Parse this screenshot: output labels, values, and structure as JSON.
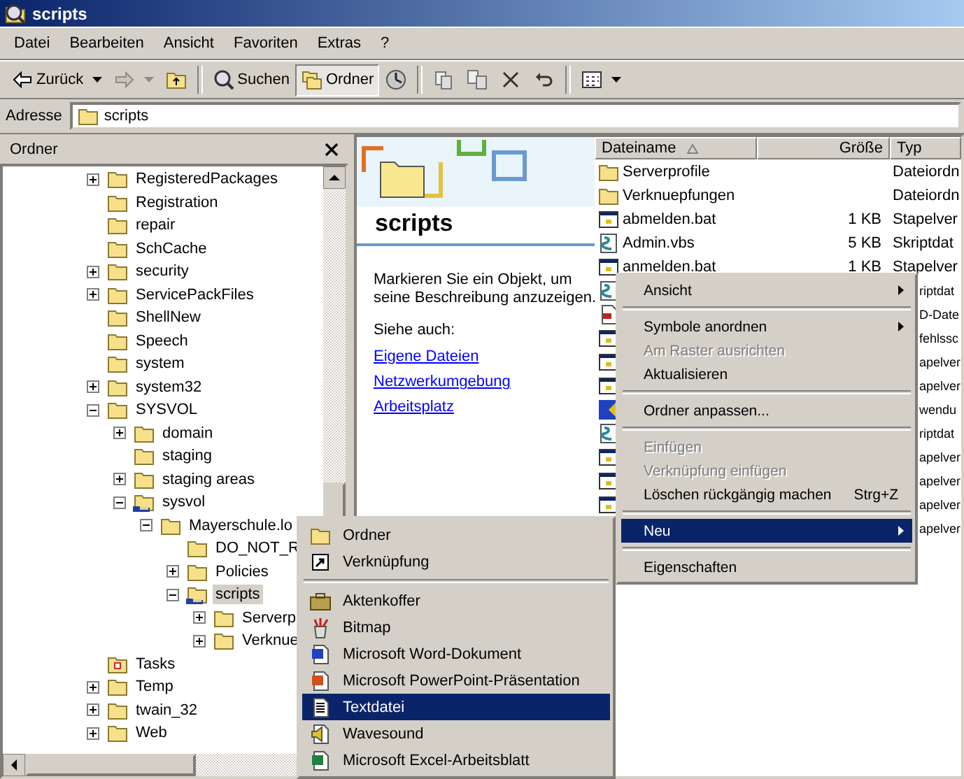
{
  "window": {
    "title": "scripts"
  },
  "menu_bar": [
    "Datei",
    "Bearbeiten",
    "Ansicht",
    "Favoriten",
    "Extras",
    "?"
  ],
  "toolbar": [
    {
      "kind": "back",
      "label": "Zurück",
      "disabled": false
    },
    {
      "kind": "forward",
      "disabled": true
    },
    {
      "kind": "up"
    },
    {
      "kind": "separator"
    },
    {
      "kind": "search",
      "label": "Suchen",
      "pressed": false
    },
    {
      "kind": "folders",
      "label": "Ordner",
      "pressed": true
    },
    {
      "kind": "history"
    },
    {
      "kind": "separator"
    },
    {
      "kind": "move"
    },
    {
      "kind": "copy"
    },
    {
      "kind": "delete"
    },
    {
      "kind": "undo"
    },
    {
      "kind": "separator"
    },
    {
      "kind": "views"
    }
  ],
  "address": {
    "label": "Adresse",
    "value": "scripts"
  },
  "folders_pane": {
    "title": "Ordner"
  },
  "tree": [
    {
      "name": "RegisteredPackages",
      "kind": "folder",
      "expanded": false,
      "selected": false
    },
    {
      "name": "Registration",
      "kind": "folder",
      "selected": false
    },
    {
      "name": "repair",
      "kind": "folder",
      "selected": false
    },
    {
      "name": "SchCache",
      "kind": "folder",
      "selected": false
    },
    {
      "name": "security",
      "kind": "folder",
      "expanded": false,
      "selected": false
    },
    {
      "name": "ServicePackFiles",
      "kind": "folder",
      "expanded": false,
      "selected": false
    },
    {
      "name": "ShellNew",
      "kind": "folder",
      "selected": false
    },
    {
      "name": "Speech",
      "kind": "folder",
      "selected": false
    },
    {
      "name": "system",
      "kind": "folder",
      "selected": false
    },
    {
      "name": "system32",
      "kind": "folder",
      "expanded": false,
      "selected": false
    },
    {
      "name": "SYSVOL",
      "kind": "folder",
      "expanded": true,
      "selected": false,
      "children": [
        {
          "name": "domain",
          "kind": "folder",
          "expanded": false,
          "selected": false
        },
        {
          "name": "staging",
          "kind": "folder",
          "selected": false
        },
        {
          "name": "staging areas",
          "kind": "folder",
          "expanded": false,
          "selected": false
        },
        {
          "name": "sysvol",
          "kind": "shared",
          "expanded": true,
          "selected": false,
          "children": [
            {
              "name": "Mayerschule.lo",
              "kind": "folder",
              "expanded": true,
              "selected": false,
              "children": [
                {
                  "name": "DO_NOT_R",
                  "kind": "folder",
                  "selected": false
                },
                {
                  "name": "Policies",
                  "kind": "folder",
                  "expanded": false,
                  "selected": false
                },
                {
                  "name": "scripts",
                  "kind": "shared",
                  "expanded": true,
                  "selected": true,
                  "children": [
                    {
                      "name": "Serverp",
                      "kind": "folder",
                      "expanded": false,
                      "selected": false
                    },
                    {
                      "name": "Verknue",
                      "kind": "folder",
                      "expanded": false,
                      "selected": false
                    }
                  ]
                }
              ]
            }
          ]
        }
      ]
    },
    {
      "name": "Tasks",
      "kind": "tasks",
      "selected": false
    },
    {
      "name": "Temp",
      "kind": "folder",
      "expanded": false,
      "selected": false
    },
    {
      "name": "twain_32",
      "kind": "folder",
      "expanded": false,
      "selected": false
    },
    {
      "name": "Web",
      "kind": "folder",
      "expanded": false,
      "selected": false
    }
  ],
  "web_view": {
    "title": "scripts",
    "hint": "Markieren Sie ein Objekt, um seine Beschreibung anzuzeigen.",
    "see_also": "Siehe auch:",
    "links": [
      "Eigene Dateien",
      "Netzwerkumgebung",
      "Arbeitsplatz"
    ]
  },
  "file_list": {
    "columns": [
      {
        "label": "Dateiname",
        "sorted": true
      },
      {
        "label": "Größe",
        "sorted": false
      },
      {
        "label": "Typ",
        "sorted": false
      }
    ],
    "rows": [
      {
        "kind": "folder",
        "name": "Serverprofile",
        "type": "Dateiordn"
      },
      {
        "kind": "folder",
        "name": "Verknuepfungen",
        "type": "Dateiordn"
      },
      {
        "kind": "bat",
        "name": "abmelden.bat",
        "size": "1 KB",
        "type": "Stapelver"
      },
      {
        "kind": "script",
        "name": "Admin.vbs",
        "size": "5 KB",
        "type": "Skriptdat"
      },
      {
        "kind": "bat",
        "name": "anmelden.bat",
        "size": "1 KB",
        "type": "Stapelver"
      },
      {
        "kind": "script",
        "type": "riptdat"
      },
      {
        "kind": "reg",
        "type": "D-Date"
      },
      {
        "kind": "bat",
        "type": "fehlssc"
      },
      {
        "kind": "bat",
        "type": "apelver"
      },
      {
        "kind": "bat",
        "type": "apelver"
      },
      {
        "kind": "app",
        "type": "wendu"
      },
      {
        "kind": "script",
        "type": "riptdat"
      },
      {
        "kind": "bat",
        "type": "apelver"
      },
      {
        "kind": "bat",
        "type": "apelver"
      },
      {
        "kind": "bat",
        "type": "apelver"
      },
      {
        "type": "apelver"
      }
    ]
  },
  "context_menu": {
    "items": [
      {
        "kind": "item",
        "label": "Ansicht",
        "submenu": true,
        "disabled": false,
        "selected": false
      },
      {
        "kind": "separator"
      },
      {
        "kind": "item",
        "label": "Symbole anordnen",
        "submenu": true,
        "disabled": false,
        "selected": false
      },
      {
        "kind": "item",
        "label": "Am Raster ausrichten",
        "disabled": true,
        "selected": false
      },
      {
        "kind": "item",
        "label": "Aktualisieren",
        "disabled": false,
        "selected": false
      },
      {
        "kind": "separator"
      },
      {
        "kind": "item",
        "label": "Ordner anpassen...",
        "disabled": false,
        "selected": false
      },
      {
        "kind": "separator"
      },
      {
        "kind": "item",
        "label": "Einfügen",
        "disabled": true,
        "selected": false
      },
      {
        "kind": "item",
        "label": "Verknüpfung einfügen",
        "disabled": true,
        "selected": false
      },
      {
        "kind": "item",
        "label": "Löschen rückgängig machen",
        "shortcut": "Strg+Z",
        "disabled": false,
        "selected": false
      },
      {
        "kind": "separator"
      },
      {
        "kind": "item",
        "label": "Neu",
        "submenu": true,
        "disabled": false,
        "selected": true
      },
      {
        "kind": "separator"
      },
      {
        "kind": "item",
        "label": "Eigenschaften",
        "disabled": false,
        "selected": false
      }
    ]
  },
  "new_submenu": {
    "items": [
      {
        "kind": "folder",
        "label": "Ordner",
        "selected": false
      },
      {
        "kind": "shortcut",
        "label": "Verknüpfung",
        "selected": false
      },
      {
        "kind": "separator"
      },
      {
        "kind": "briefcase",
        "label": "Aktenkoffer",
        "selected": false
      },
      {
        "kind": "bitmap",
        "label": "Bitmap",
        "selected": false
      },
      {
        "kind": "word",
        "label": "Microsoft Word-Dokument",
        "selected": false
      },
      {
        "kind": "ppt",
        "label": "Microsoft PowerPoint-Präsentation",
        "selected": false
      },
      {
        "kind": "text",
        "label": "Textdatei",
        "selected": true
      },
      {
        "kind": "wave",
        "label": "Wavesound",
        "selected": false
      },
      {
        "kind": "excel",
        "label": "Microsoft Excel-Arbeitsblatt",
        "selected": false
      }
    ]
  }
}
